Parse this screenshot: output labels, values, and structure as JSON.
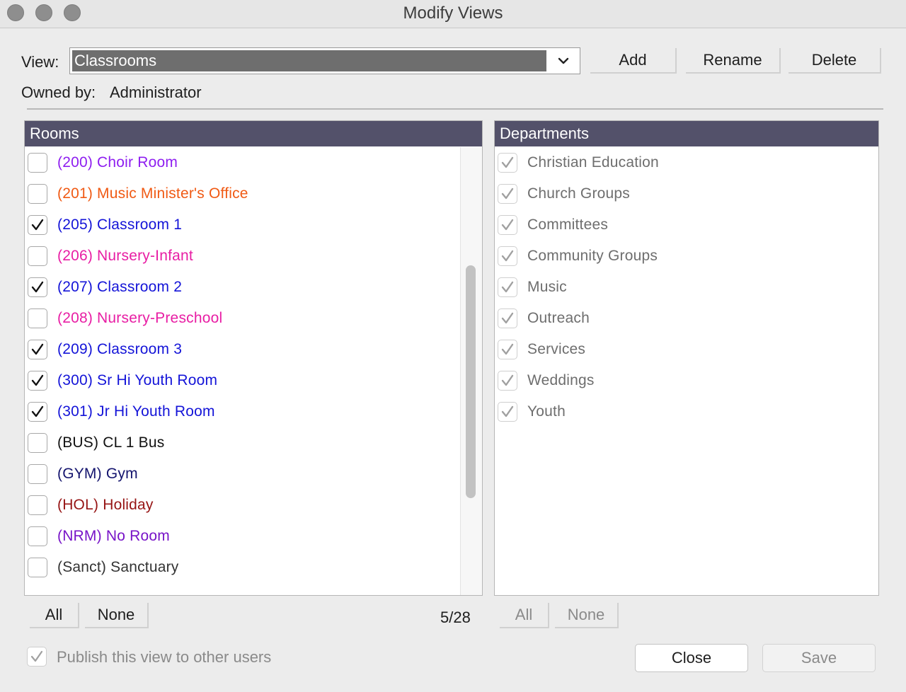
{
  "window": {
    "title": "Modify Views"
  },
  "view": {
    "label": "View:",
    "selected": "Classrooms",
    "owned_by_label": "Owned by:",
    "owner": "Administrator",
    "add_label": "Add",
    "rename_label": "Rename",
    "delete_label": "Delete"
  },
  "rooms": {
    "header": "Rooms",
    "count": "5/28",
    "all_label": "All",
    "none_label": "None",
    "scroll_position": 0.55,
    "scroll_visible_fraction": 0.52,
    "items": [
      {
        "label": "(200) Choir Room",
        "checked": false,
        "color": "#8e1ef0"
      },
      {
        "label": "(201) Music Minister's Office",
        "checked": false,
        "color": "#f05a14"
      },
      {
        "label": "(205) Classroom 1",
        "checked": true,
        "color": "#1414d8"
      },
      {
        "label": "(206) Nursery-Infant",
        "checked": false,
        "color": "#e81ea4"
      },
      {
        "label": "(207) Classroom 2",
        "checked": true,
        "color": "#1414d8"
      },
      {
        "label": "(208) Nursery-Preschool",
        "checked": false,
        "color": "#e81ea4"
      },
      {
        "label": "(209) Classroom 3",
        "checked": true,
        "color": "#1414d8"
      },
      {
        "label": "(300) Sr Hi Youth Room",
        "checked": true,
        "color": "#1414d8"
      },
      {
        "label": "(301) Jr Hi Youth Room",
        "checked": true,
        "color": "#1414d8"
      },
      {
        "label": "(BUS) CL 1 Bus",
        "checked": false,
        "color": "#111111"
      },
      {
        "label": "(GYM) Gym",
        "checked": false,
        "color": "#14146e"
      },
      {
        "label": "(HOL) Holiday",
        "checked": false,
        "color": "#961414"
      },
      {
        "label": "(NRM) No Room",
        "checked": false,
        "color": "#7814c8"
      },
      {
        "label": "(Sanct) Sanctuary",
        "checked": false,
        "color": "#333333"
      }
    ]
  },
  "departments": {
    "header": "Departments",
    "all_label": "All",
    "none_label": "None",
    "items": [
      {
        "label": "Christian Education",
        "checked": true
      },
      {
        "label": "Church Groups",
        "checked": true
      },
      {
        "label": "Committees",
        "checked": true
      },
      {
        "label": "Community Groups",
        "checked": true
      },
      {
        "label": "Music",
        "checked": true
      },
      {
        "label": "Outreach",
        "checked": true
      },
      {
        "label": "Services",
        "checked": true
      },
      {
        "label": "Weddings",
        "checked": true
      },
      {
        "label": "Youth",
        "checked": true
      }
    ]
  },
  "footer": {
    "publish_label": "Publish this view to other users",
    "publish_checked": true,
    "close_label": "Close",
    "save_label": "Save"
  }
}
